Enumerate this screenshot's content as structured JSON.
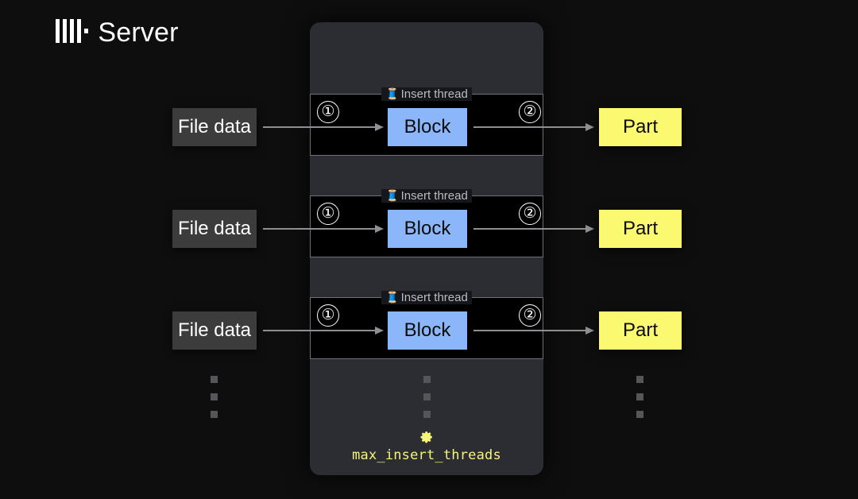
{
  "background_color": "#0e0e0e",
  "server": {
    "title": "Server",
    "logo_icon": "clickhouse-logo-icon",
    "panel_color": "#2b2d33"
  },
  "threads": [
    {
      "group_label": "Insert thread",
      "group_icon": "thread-spool-icon",
      "source_label": "File data",
      "block_label": "Block",
      "output_label": "Part",
      "step_in": "①",
      "step_out": "②"
    },
    {
      "group_label": "Insert thread",
      "group_icon": "thread-spool-icon",
      "source_label": "File data",
      "block_label": "Block",
      "output_label": "Part",
      "step_in": "①",
      "step_out": "②"
    },
    {
      "group_label": "Insert thread",
      "group_icon": "thread-spool-icon",
      "source_label": "File data",
      "block_label": "Block",
      "output_label": "Part",
      "step_in": "①",
      "step_out": "②"
    }
  ],
  "setting": {
    "icon": "gear-icon",
    "label": "max_insert_threads",
    "color": "#f6f57a"
  },
  "colors": {
    "file_data_box": "#3c3c3c",
    "block_box": "#8cb6fa",
    "part_box": "#fbf96f",
    "arrow": "#8d8f94",
    "group_border": "#6d7078",
    "group_fill": "#000000",
    "ellipsis_dot": "#55565a"
  },
  "ellipsis": {
    "dot_count": 3,
    "columns": [
      "left",
      "center",
      "right"
    ]
  }
}
